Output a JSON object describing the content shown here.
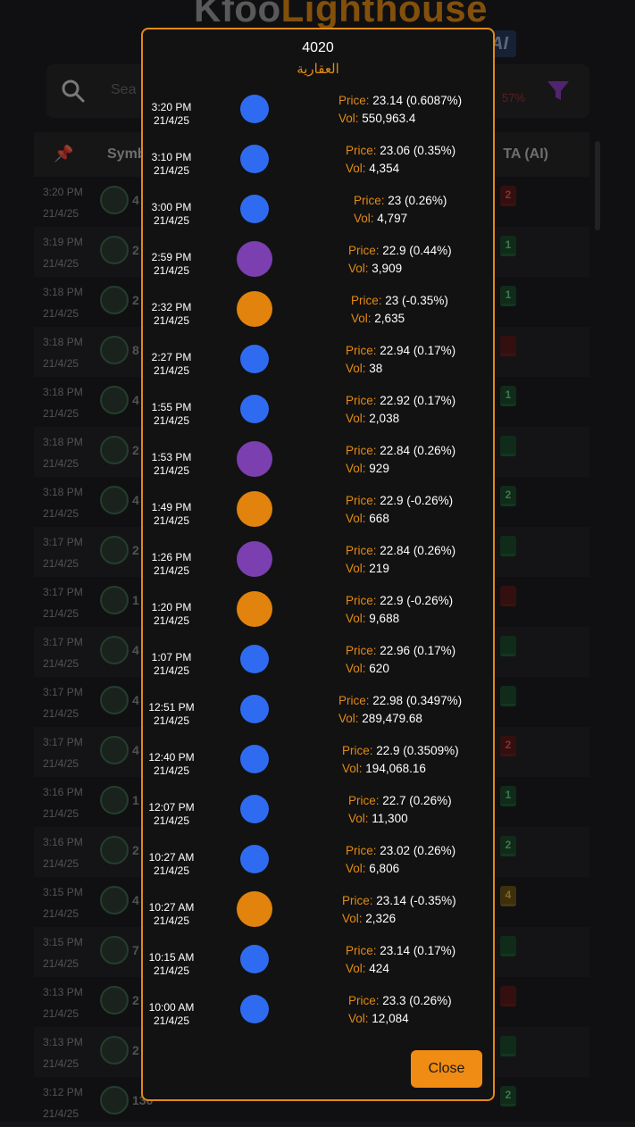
{
  "app": {
    "logo_part1": "Kfoo",
    "logo_part2": "Lighthouse",
    "badge": "AI",
    "search_placeholder": "Sea",
    "search_percent": "57%",
    "table_header": {
      "symbol": "Symb",
      "ta": "TA (AI)"
    },
    "rows": [
      {
        "time": "3:20 PM",
        "date": "21/4/25",
        "num": "4",
        "ta": "2",
        "ta_color": "r"
      },
      {
        "time": "3:19 PM",
        "date": "21/4/25",
        "num": "2",
        "ta": "1",
        "ta_color": "g"
      },
      {
        "time": "3:18 PM",
        "date": "21/4/25",
        "num": "2",
        "ta": "1",
        "ta_color": "g"
      },
      {
        "time": "3:18 PM",
        "date": "21/4/25",
        "num": "8",
        "ta": "",
        "ta_color": "r"
      },
      {
        "time": "3:18 PM",
        "date": "21/4/25",
        "num": "4",
        "ta": "1",
        "ta_color": "g"
      },
      {
        "time": "3:18 PM",
        "date": "21/4/25",
        "num": "2",
        "ta": "",
        "ta_color": "g"
      },
      {
        "time": "3:18 PM",
        "date": "21/4/25",
        "num": "4",
        "ta": "2",
        "ta_color": "g"
      },
      {
        "time": "3:17 PM",
        "date": "21/4/25",
        "num": "2",
        "ta": "",
        "ta_color": "g"
      },
      {
        "time": "3:17 PM",
        "date": "21/4/25",
        "num": "1",
        "ta": "",
        "ta_color": "r"
      },
      {
        "time": "3:17 PM",
        "date": "21/4/25",
        "num": "4",
        "ta": "",
        "ta_color": "g"
      },
      {
        "time": "3:17 PM",
        "date": "21/4/25",
        "num": "4",
        "ta": "",
        "ta_color": "g"
      },
      {
        "time": "3:17 PM",
        "date": "21/4/25",
        "num": "4",
        "ta": "2",
        "ta_color": "r"
      },
      {
        "time": "3:16 PM",
        "date": "21/4/25",
        "num": "1",
        "ta": "1",
        "ta_color": "g"
      },
      {
        "time": "3:16 PM",
        "date": "21/4/25",
        "num": "2",
        "ta": "2",
        "ta_color": "g"
      },
      {
        "time": "3:15 PM",
        "date": "21/4/25",
        "num": "4",
        "ta": "4",
        "ta_color": "y"
      },
      {
        "time": "3:15 PM",
        "date": "21/4/25",
        "num": "7",
        "ta": "",
        "ta_color": "g"
      },
      {
        "time": "3:13 PM",
        "date": "21/4/25",
        "num": "2",
        "ta": "",
        "ta_color": "r"
      },
      {
        "time": "3:13 PM",
        "date": "21/4/25",
        "num": "2",
        "ta": "",
        "ta_color": "g"
      },
      {
        "time": "3:12 PM",
        "date": "21/4/25",
        "num": "130",
        "ta": "2",
        "ta_color": "g"
      }
    ]
  },
  "modal": {
    "title": "4020",
    "subtitle": "العقارية",
    "price_label": "Price:",
    "vol_label": "Vol:",
    "close_label": "Close",
    "colors": {
      "blue": "#2f6bf0",
      "purple": "#7b3fb0",
      "orange": "#e1830c",
      "accent": "#e28a14"
    },
    "trades": [
      {
        "time": "3:20 PM",
        "date": "21/4/25",
        "dot": "blue",
        "price": "23.14 (0.6087%)",
        "vol": "550,963.4"
      },
      {
        "time": "3:10 PM",
        "date": "21/4/25",
        "dot": "blue",
        "price": "23.06 (0.35%)",
        "vol": "4,354"
      },
      {
        "time": "3:00 PM",
        "date": "21/4/25",
        "dot": "blue",
        "price": "23 (0.26%)",
        "vol": "4,797"
      },
      {
        "time": "2:59 PM",
        "date": "21/4/25",
        "dot": "purple",
        "price": "22.9 (0.44%)",
        "vol": "3,909"
      },
      {
        "time": "2:32 PM",
        "date": "21/4/25",
        "dot": "orange",
        "price": "23 (-0.35%)",
        "vol": "2,635"
      },
      {
        "time": "2:27 PM",
        "date": "21/4/25",
        "dot": "blue",
        "price": "22.94 (0.17%)",
        "vol": "38"
      },
      {
        "time": "1:55 PM",
        "date": "21/4/25",
        "dot": "blue",
        "price": "22.92 (0.17%)",
        "vol": "2,038"
      },
      {
        "time": "1:53 PM",
        "date": "21/4/25",
        "dot": "purple",
        "price": "22.84 (0.26%)",
        "vol": "929"
      },
      {
        "time": "1:49 PM",
        "date": "21/4/25",
        "dot": "orange",
        "price": "22.9 (-0.26%)",
        "vol": "668"
      },
      {
        "time": "1:26 PM",
        "date": "21/4/25",
        "dot": "purple",
        "price": "22.84 (0.26%)",
        "vol": "219"
      },
      {
        "time": "1:20 PM",
        "date": "21/4/25",
        "dot": "orange",
        "price": "22.9 (-0.26%)",
        "vol": "9,688"
      },
      {
        "time": "1:07 PM",
        "date": "21/4/25",
        "dot": "blue",
        "price": "22.96 (0.17%)",
        "vol": "620"
      },
      {
        "time": "12:51 PM",
        "date": "21/4/25",
        "dot": "blue",
        "price": "22.98 (0.3497%)",
        "vol": "289,479.68"
      },
      {
        "time": "12:40 PM",
        "date": "21/4/25",
        "dot": "blue",
        "price": "22.9 (0.3509%)",
        "vol": "194,068.16"
      },
      {
        "time": "12:07 PM",
        "date": "21/4/25",
        "dot": "blue",
        "price": "22.7 (0.26%)",
        "vol": "11,300"
      },
      {
        "time": "10:27 AM",
        "date": "21/4/25",
        "dot": "blue",
        "price": "23.02 (0.26%)",
        "vol": "6,806"
      },
      {
        "time": "10:27 AM",
        "date": "21/4/25",
        "dot": "orange",
        "price": "23.14 (-0.35%)",
        "vol": "2,326"
      },
      {
        "time": "10:15 AM",
        "date": "21/4/25",
        "dot": "blue",
        "price": "23.14 (0.17%)",
        "vol": "424"
      },
      {
        "time": "10:00 AM",
        "date": "21/4/25",
        "dot": "blue",
        "price": "23.3 (0.26%)",
        "vol": "12,084"
      }
    ]
  }
}
